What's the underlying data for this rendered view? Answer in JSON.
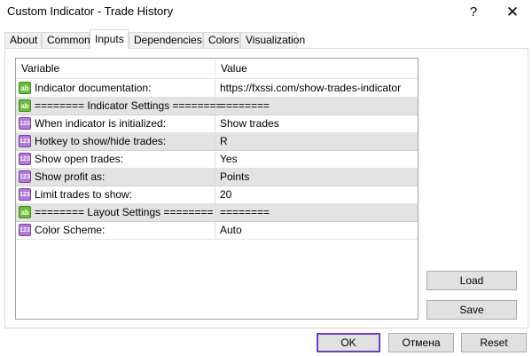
{
  "window": {
    "title": "Custom Indicator - Trade History",
    "help_glyph": "?",
    "close_glyph": "✕"
  },
  "tabs": [
    {
      "label": "About",
      "active": false
    },
    {
      "label": "Common",
      "active": false
    },
    {
      "label": "Inputs",
      "active": true
    },
    {
      "label": "Dependencies",
      "active": false
    },
    {
      "label": "Colors",
      "active": false
    },
    {
      "label": "Visualization",
      "active": false
    }
  ],
  "grid": {
    "headers": {
      "variable": "Variable",
      "value": "Value"
    },
    "rows": [
      {
        "icon": "string-icon",
        "icon_text": "ab",
        "variable": "Indicator documentation:",
        "value": "https://fxssi.com/show-trades-indicator",
        "separator": false
      },
      {
        "icon": "string-icon",
        "icon_text": "ab",
        "variable": "======== Indicator Settings ========",
        "value": "========",
        "separator": true
      },
      {
        "icon": "number-icon",
        "icon_text": "123",
        "variable": "When indicator is initialized:",
        "value": "Show trades",
        "separator": false
      },
      {
        "icon": "number-icon",
        "icon_text": "123",
        "variable": "Hotkey to show/hide trades:",
        "value": "R",
        "separator": false
      },
      {
        "icon": "number-icon",
        "icon_text": "123",
        "variable": "Show open trades:",
        "value": "Yes",
        "separator": false
      },
      {
        "icon": "number-icon",
        "icon_text": "123",
        "variable": "Show profit as:",
        "value": "Points",
        "separator": false
      },
      {
        "icon": "number-icon",
        "icon_text": "123",
        "variable": "Limit trades to show:",
        "value": "20",
        "separator": false
      },
      {
        "icon": "string-icon",
        "icon_text": "ab",
        "variable": "======== Layout Settings ========",
        "value": "========",
        "separator": true
      },
      {
        "icon": "number-icon",
        "icon_text": "123",
        "variable": "Color Scheme:",
        "value": "Auto",
        "separator": false
      }
    ]
  },
  "buttons": {
    "load": "Load",
    "save": "Save",
    "ok": "OK",
    "cancel": "Отмена",
    "reset": "Reset"
  },
  "colors": {
    "focus_border": "#6a3fbf",
    "separator_row": "#e3e3e3",
    "string_icon": "#6dbb3a",
    "number_icon": "#b07ad6"
  }
}
